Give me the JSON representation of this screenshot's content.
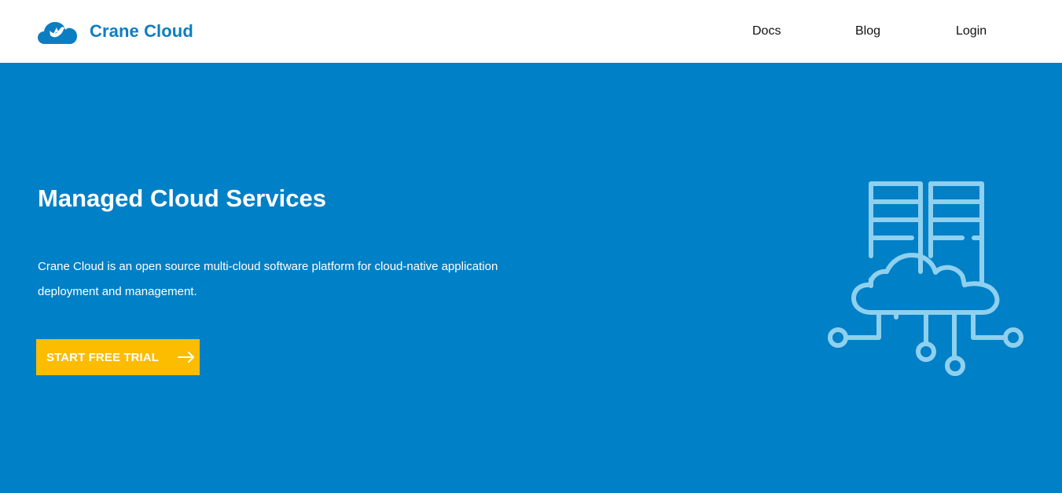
{
  "brand": {
    "name": "Crane Cloud",
    "logo_icon": "cloud-bird-logo",
    "color": "#0d7dc2"
  },
  "nav": {
    "items": [
      {
        "label": "Docs"
      },
      {
        "label": "Blog"
      },
      {
        "label": "Login"
      }
    ]
  },
  "hero": {
    "title": "Managed Cloud Services",
    "description": "Crane Cloud is an open source multi-cloud software platform for cloud-native application deployment and management.",
    "cta_label": "START FREE TRIAL",
    "cta_icon": "arrow-right-icon",
    "illustration_icon": "cloud-servers-network-icon"
  },
  "colors": {
    "hero_background": "#0080c6",
    "cta_background": "#fcbc00",
    "illustration_stroke": "#8fd0ef",
    "nav_background": "#ffffff"
  }
}
